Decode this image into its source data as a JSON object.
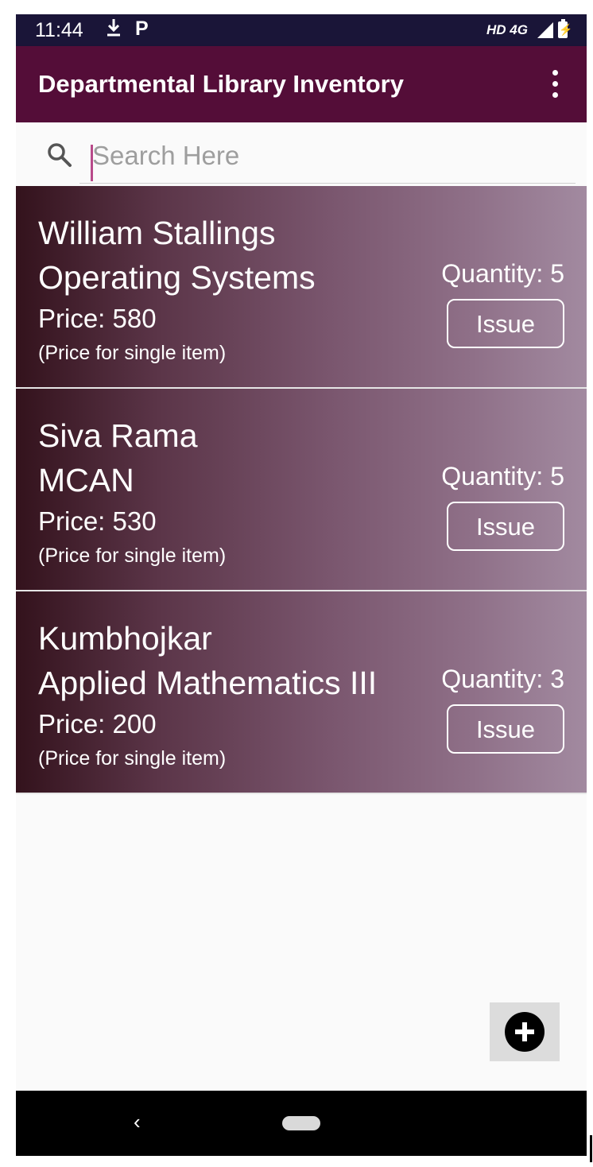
{
  "status_bar": {
    "time": "11:44",
    "download_icon": "download-icon",
    "notification_letter": "P",
    "network": "HD 4G",
    "battery_glyph": "⚡"
  },
  "app_bar": {
    "title": "Departmental Library Inventory",
    "menu_icon": "more-vert-icon"
  },
  "search": {
    "placeholder": "Search Here",
    "value": ""
  },
  "books": [
    {
      "author": "William Stallings",
      "title": "Operating Systems",
      "price": "Price: 580",
      "note": "(Price for single item)",
      "quantity": "Quantity: 5",
      "action": "Issue"
    },
    {
      "author": "Siva Rama",
      "title": "MCAN",
      "price": "Price: 530",
      "note": "(Price for single item)",
      "quantity": "Quantity: 5",
      "action": "Issue"
    },
    {
      "author": "Kumbhojkar",
      "title": "Applied Mathematics III",
      "price": "Price: 200",
      "note": "(Price for single item)",
      "quantity": "Quantity: 3",
      "action": "Issue"
    }
  ],
  "fab": {
    "icon": "add-circle-icon"
  },
  "nav_bar": {
    "back_glyph": "‹"
  },
  "colors": {
    "app_bar": "#540d38",
    "status_bar": "#1a1538",
    "card_gradient_start": "#33121c",
    "card_gradient_end": "#a28aa0"
  }
}
